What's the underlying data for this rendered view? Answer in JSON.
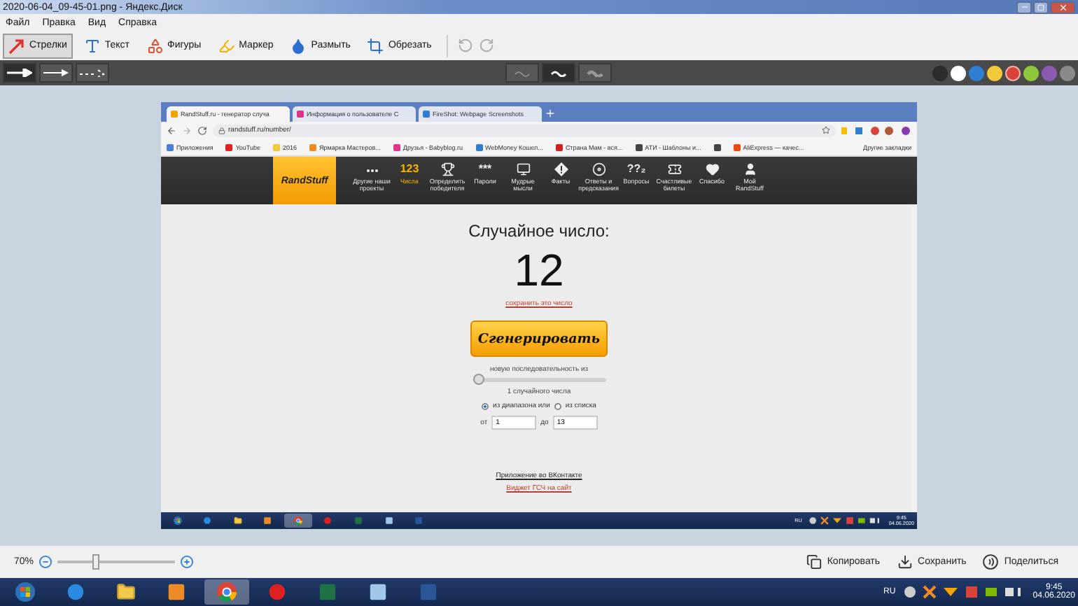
{
  "window": {
    "title": "2020-06-04_09-45-01.png - Яндекс.Диск"
  },
  "menu": [
    "Файл",
    "Правка",
    "Вид",
    "Справка"
  ],
  "tools": [
    {
      "kind": "arrow",
      "label": "Стрелки",
      "selected": true
    },
    {
      "kind": "text",
      "label": "Текст",
      "selected": false
    },
    {
      "kind": "shapes",
      "label": "Фигуры",
      "selected": false
    },
    {
      "kind": "marker",
      "label": "Маркер",
      "selected": false
    },
    {
      "kind": "blur",
      "label": "Размыть",
      "selected": false
    },
    {
      "kind": "crop",
      "label": "Обрезать",
      "selected": false
    }
  ],
  "arrow_styles": [
    {
      "kind": "bold",
      "selected": true
    },
    {
      "kind": "thin",
      "selected": false
    },
    {
      "kind": "dotted",
      "selected": false
    }
  ],
  "line_styles": [
    {
      "kind": "thin",
      "selected": false
    },
    {
      "kind": "medium",
      "selected": true
    },
    {
      "kind": "thick",
      "selected": false
    }
  ],
  "colors": [
    {
      "color": "#2b2b2b",
      "selected": false
    },
    {
      "color": "#ffffff",
      "selected": false
    },
    {
      "color": "#2f7ed0",
      "selected": false
    },
    {
      "color": "#f2c93b",
      "selected": false
    },
    {
      "color": "#d9443a",
      "selected": true
    },
    {
      "color": "#8fc93a",
      "selected": false
    },
    {
      "color": "#8a5bb0",
      "selected": false
    },
    {
      "color": "#8a8a8a",
      "selected": false
    }
  ],
  "screenshot": {
    "tabs": [
      {
        "label": "RandStuff.ru - генератор случа",
        "color": "#f2a400",
        "selected": true
      },
      {
        "label": "Информация о пользователе С",
        "color": "#e0338a",
        "selected": false
      },
      {
        "label": "FireShot: Webpage Screenshots",
        "color": "#2f7ed0",
        "selected": false
      }
    ],
    "url": "randstuff.ru/number/",
    "bookmarks": [
      {
        "label": "Приложения",
        "color": "#4a7fd8"
      },
      {
        "label": "YouTube",
        "color": "#e02020"
      },
      {
        "label": "2016",
        "color": "#f2c93b"
      },
      {
        "label": "Ярмарка Мастеров...",
        "color": "#f08a24"
      },
      {
        "label": "Друзья - Babyblog.ru",
        "color": "#e0338a"
      },
      {
        "label": "WebMoney Кошел...",
        "color": "#2f7ed0"
      },
      {
        "label": "Страна Мам - вся...",
        "color": "#d02020"
      },
      {
        "label": "АТИ - Шаблоны и...",
        "color": "#444444"
      },
      {
        "color": "#444444"
      },
      {
        "label": "AliExpress — качес...",
        "color": "#e84a10"
      }
    ],
    "other_bookmarks": "Другие закладки",
    "logo": "RandStuff",
    "nav": [
      {
        "kind": "dots",
        "label": "Другие наши проекты",
        "selected": false
      },
      {
        "kind": "glyph",
        "glyph": "123",
        "label": "Числа",
        "selected": true
      },
      {
        "kind": "trophy",
        "label": "Определить победителя",
        "selected": false
      },
      {
        "kind": "glyph",
        "glyph": "***",
        "label": "Пароли",
        "selected": false
      },
      {
        "kind": "monitor",
        "label": "Мудрые мысли",
        "selected": false
      },
      {
        "kind": "diamond",
        "label": "Факты",
        "selected": false
      },
      {
        "kind": "disc",
        "label": "Ответы и предсказания",
        "selected": false
      },
      {
        "kind": "glyph",
        "glyph": "??₂",
        "label": "Вопросы",
        "selected": false
      },
      {
        "kind": "ticket",
        "label": "Счастливые билеты",
        "selected": false
      },
      {
        "kind": "heart",
        "label": "Спасибо",
        "selected": false
      },
      {
        "kind": "person",
        "label": "Мой RandStuff",
        "selected": false
      }
    ],
    "heading": "Случайное число:",
    "number": "12",
    "save_link": "сохранить это число",
    "button": "Сгенерировать",
    "sequence_label": "новую последовательность из",
    "sequence": {
      "level": 0
    },
    "count": "1 случайного числа",
    "sources": [
      {
        "label": "из диапазона или",
        "selected": true
      },
      {
        "label": "из списка",
        "selected": false
      }
    ],
    "from_label": "от",
    "from_value": "1",
    "to_label": "до",
    "to_value": "13",
    "vk_link": "Приложение во ВКонтакте",
    "widget_link": "Виджет ГСЧ на сайт",
    "taskbar": {
      "apps": [
        {
          "kind": "start",
          "selected": false
        },
        {
          "kind": "ie",
          "selected": false
        },
        {
          "kind": "folder",
          "selected": false
        },
        {
          "kind": "media",
          "selected": false
        },
        {
          "kind": "chrome",
          "selected": true
        },
        {
          "kind": "yandex",
          "selected": false
        },
        {
          "kind": "excel",
          "selected": false
        },
        {
          "kind": "notepad",
          "selected": false
        },
        {
          "kind": "word",
          "selected": false
        }
      ],
      "lang": "RU",
      "time": "9:45",
      "date": "04.06.2020"
    }
  },
  "zoom": {
    "value": "70%",
    "level": 0.3
  },
  "actions": [
    {
      "kind": "copy",
      "label": "Копировать"
    },
    {
      "kind": "save",
      "label": "Сохранить"
    },
    {
      "kind": "share",
      "label": "Поделиться"
    }
  ],
  "taskbar": {
    "apps": [
      {
        "kind": "start",
        "selected": false
      },
      {
        "kind": "ie",
        "selected": false
      },
      {
        "kind": "folder",
        "selected": false
      },
      {
        "kind": "media",
        "selected": false
      },
      {
        "kind": "chrome",
        "selected": true
      },
      {
        "kind": "yandex",
        "selected": false
      },
      {
        "kind": "excel",
        "selected": false
      },
      {
        "kind": "notepad",
        "selected": false
      },
      {
        "kind": "word",
        "selected": false
      }
    ],
    "lang": "RU",
    "time": "9:45",
    "date": "04.06.2020"
  }
}
